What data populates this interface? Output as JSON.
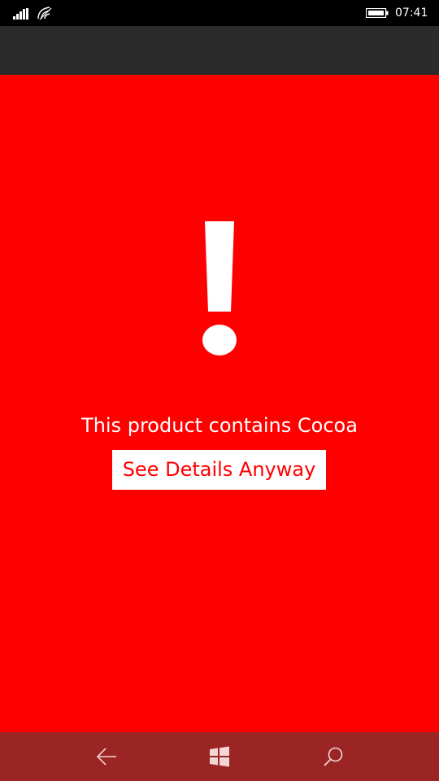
{
  "status_bar": {
    "time": "07:41"
  },
  "alert": {
    "message": "This product contains Cocoa",
    "button_label": "See Details Anyway"
  },
  "nav_bar": {
    "back_icon": "back-arrow-icon",
    "home_icon": "windows-logo-icon",
    "search_icon": "search-icon"
  },
  "colors": {
    "alert_background": "#ff0000",
    "title_bar": "#2b2b2b",
    "nav_bar": "#9b2424",
    "status_bar": "#000000",
    "text": "#ffffff"
  }
}
